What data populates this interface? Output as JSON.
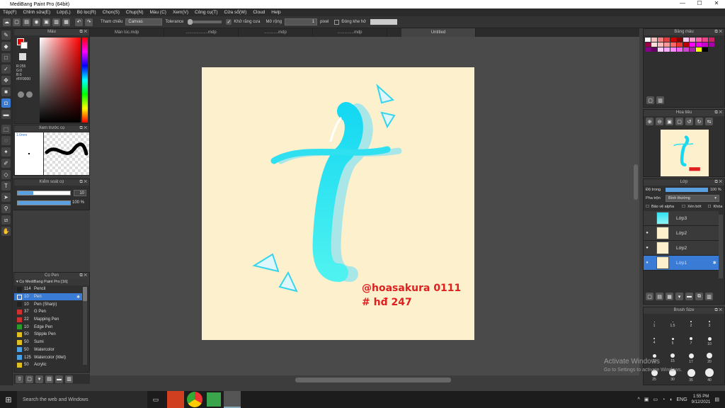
{
  "window": {
    "title": "MediBang Paint Pro (64bit)"
  },
  "menu": [
    "Tệp(F)",
    "Chỉnh sửa(E)",
    "Lớp(L)",
    "Bộ lọc(R)",
    "Chọn(S)",
    "Chụp(N)",
    "Màu (C)",
    "Xem(V)",
    "Công cụ(T)",
    "Cửa sổ(W)",
    "Cloud",
    "Help"
  ],
  "toolbar": {
    "ref_label": "Tham chiếu",
    "ref_value": "Canvas",
    "tolerance_label": "Tolerance",
    "antialias_label": "Khử răng cưa",
    "expand_label": "Mở rộng",
    "expand_value": "1",
    "pixel_label": "pixel",
    "close_gap_label": "Đóng khe hở"
  },
  "tabs": [
    "Màn lúc.mdp",
    "...................mdp",
    "............mdp",
    "..............mdp",
    "Untitled"
  ],
  "color_panel": {
    "title": "Màu",
    "r": "R:255",
    "g": "G:0",
    "b": "B:0",
    "hex": "#FF0000"
  },
  "brush_preview": {
    "title": "Xem trước cọ",
    "size": "1.0mm"
  },
  "brush_control": {
    "title": "Kiểm soát cọ",
    "size": "10",
    "opacity": "100 %"
  },
  "brush_panel": {
    "title": "Cọ Pen",
    "group": "Cọ MediBang Paint Pro [16]",
    "items": [
      {
        "size": "114",
        "name": "Pencil",
        "color": "#222222"
      },
      {
        "size": "10",
        "name": "Pen",
        "color": "#3a7bd5"
      },
      {
        "size": "10",
        "name": "Pen (Sharp)",
        "color": "#222222"
      },
      {
        "size": "37",
        "name": "G Pen",
        "color": "#d03030"
      },
      {
        "size": "22",
        "name": "Mapping Pen",
        "color": "#d03030"
      },
      {
        "size": "10",
        "name": "Edge Pen",
        "color": "#2a9a2a"
      },
      {
        "size": "50",
        "name": "Stipple Pen",
        "color": "#e0c020"
      },
      {
        "size": "50",
        "name": "Sumi",
        "color": "#e0c020"
      },
      {
        "size": "50",
        "name": "Watercolor",
        "color": "#4aa0e0"
      },
      {
        "size": "125",
        "name": "Watercolor (Wet)",
        "color": "#4aa0e0"
      },
      {
        "size": "50",
        "name": "Acrylic",
        "color": "#e0c020"
      }
    ]
  },
  "palette_panel": {
    "title": "Bảng màu"
  },
  "navigator": {
    "title": "Hoa tiêu"
  },
  "layers_panel": {
    "title": "Lớp",
    "opacity_label": "Độ trong",
    "opacity_value": "100 %",
    "blend_label": "Pha trộn",
    "blend_value": "Bình thường",
    "protect_alpha": "Bảo vệ alpha",
    "clipping": "Xén bớt",
    "lock": "Khóa",
    "layers": [
      {
        "name": "Lớp3",
        "selected": false
      },
      {
        "name": "Lớp2",
        "selected": false
      },
      {
        "name": "Lớp2",
        "selected": false
      },
      {
        "name": "Lớp1",
        "selected": true
      }
    ]
  },
  "brush_size_panel": {
    "title": "Brush Size",
    "labels": [
      "1",
      "1.5",
      "2",
      "3",
      "4",
      "5",
      "7",
      "10",
      "12",
      "15",
      "17",
      "20",
      "25",
      "30",
      "35",
      "40"
    ]
  },
  "artwork": {
    "signature_line1": "@hoasakura 0111",
    "signature_line2": "# hđ 247"
  },
  "activation": {
    "line1": "Activate Windows",
    "line2": "Go to Settings to activate Windows."
  },
  "taskbar": {
    "search": "Search the web and Windows",
    "lang": "ENG",
    "time": "1:55 PM",
    "date": "9/12/2021"
  }
}
